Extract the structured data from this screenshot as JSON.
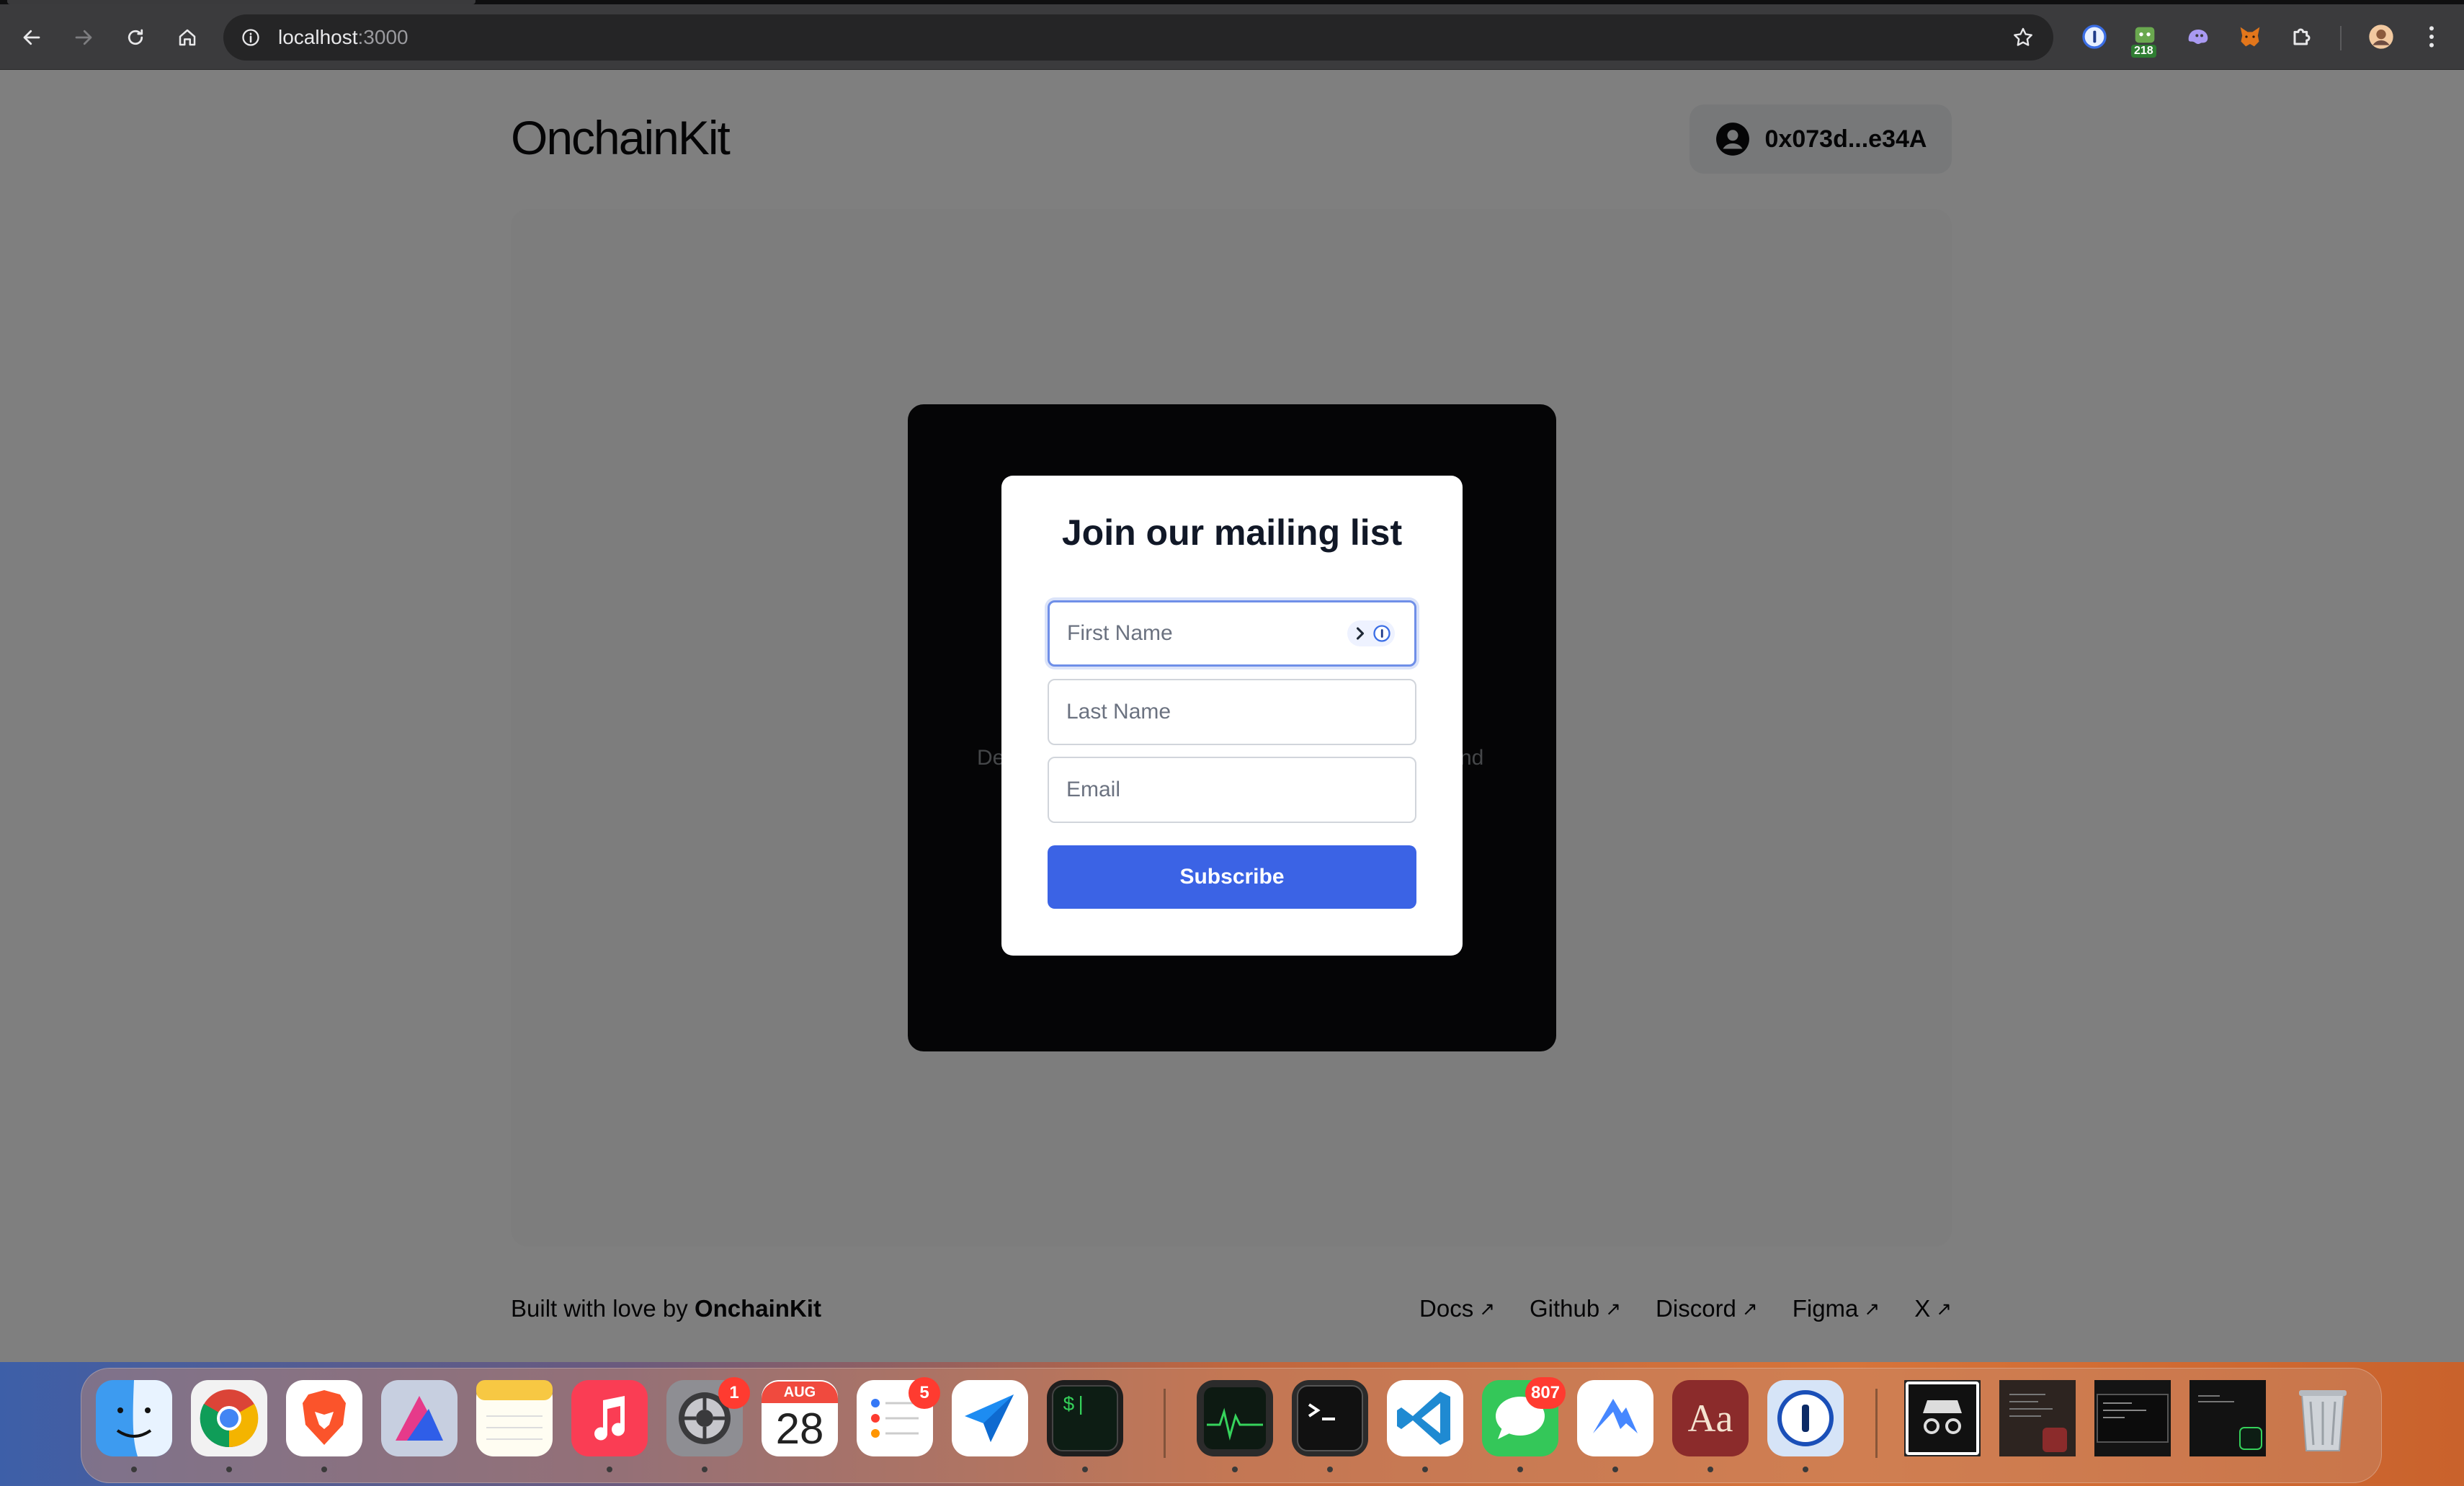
{
  "browser": {
    "url_host": "localhost",
    "url_port": ":3000",
    "extension_badge": "218"
  },
  "page": {
    "logo": "OnchainKit",
    "wallet_address": "0x073d...e34A",
    "panel_text_left": "De",
    "panel_text_right": "nd",
    "footer": {
      "built_prefix": "Built with love by ",
      "built_brand": "OnchainKit",
      "links": [
        "Docs",
        "Github",
        "Discord",
        "Figma",
        "X"
      ],
      "link_arrow": "↗"
    }
  },
  "modal": {
    "title": "Join our mailing list",
    "first_name_placeholder": "First Name",
    "last_name_placeholder": "Last Name",
    "email_placeholder": "Email",
    "subscribe_label": "Subscribe"
  },
  "dock": {
    "apps": [
      {
        "name": "Finder",
        "icon": "finder-icon"
      },
      {
        "name": "Chrome",
        "icon": "chrome-icon"
      },
      {
        "name": "Brave",
        "icon": "brave-icon"
      },
      {
        "name": "Affinity",
        "icon": "affinity-icon"
      },
      {
        "name": "Notes",
        "icon": "notes-icon"
      },
      {
        "name": "Music",
        "icon": "music-icon"
      },
      {
        "name": "System Settings",
        "icon": "settings-icon",
        "badge": "1"
      },
      {
        "name": "Calendar",
        "icon": "calendar-icon",
        "month": "AUG",
        "day": "28"
      },
      {
        "name": "Reminders",
        "icon": "reminders-icon",
        "badge": "5"
      },
      {
        "name": "Direct Mail",
        "icon": "paper-plane-icon"
      },
      {
        "name": "Terminal Dev",
        "icon": "terminal-icon"
      },
      {
        "name": "Activity Monitor",
        "icon": "activity-monitor-icon"
      },
      {
        "name": "Terminal",
        "icon": "terminal-prompt-icon"
      },
      {
        "name": "VS Code",
        "icon": "vscode-icon"
      },
      {
        "name": "Messages",
        "icon": "messages-icon",
        "badge": "807"
      },
      {
        "name": "NordVPN",
        "icon": "nordvpn-icon"
      },
      {
        "name": "Dictionary",
        "icon": "dictionary-icon",
        "label": "Aa"
      },
      {
        "name": "1Password",
        "icon": "1password-icon"
      }
    ]
  },
  "colors": {
    "accent": "#3b63e5",
    "badge": "#ff3b30"
  }
}
